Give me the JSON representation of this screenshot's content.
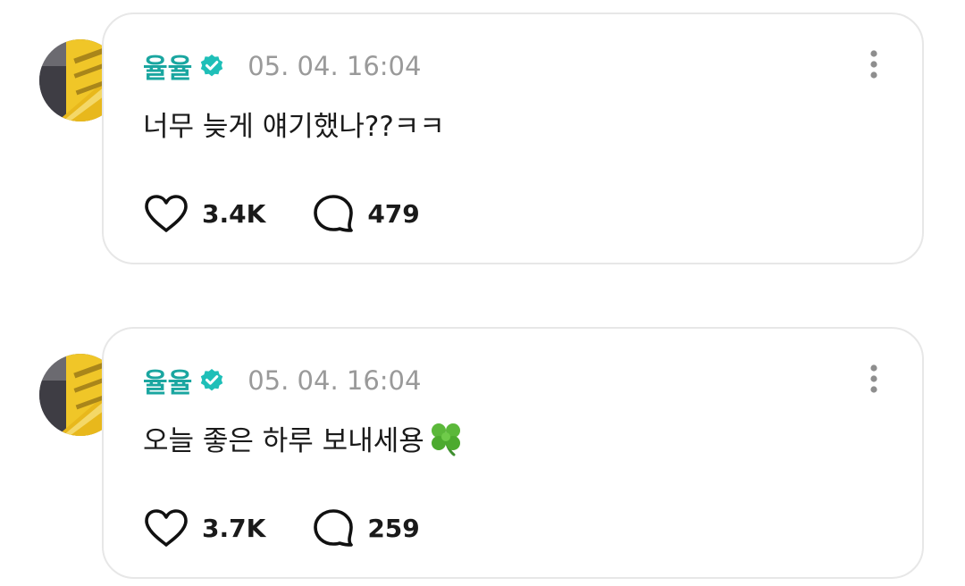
{
  "posts": [
    {
      "author": "율율",
      "verified": true,
      "timestamp": "05. 04. 16:04",
      "text": "너무 늦게 얘기했나??ㅋㅋ",
      "emoji": "",
      "likes": "3.4K",
      "comments": "479"
    },
    {
      "author": "율율",
      "verified": true,
      "timestamp": "05. 04. 16:04",
      "text": "오늘 좋은 하루 보내세용",
      "emoji": "🍀",
      "likes": "3.7K",
      "comments": "259"
    }
  ],
  "colors": {
    "author": "#1aa6a0",
    "verified_badge": "#1fbfb8",
    "timestamp": "#9a9a9a",
    "card_border": "#e7e7e7"
  },
  "icons": [
    "verified-badge-icon",
    "more-options-icon",
    "heart-icon",
    "comment-bubble-icon",
    "clover-icon"
  ]
}
